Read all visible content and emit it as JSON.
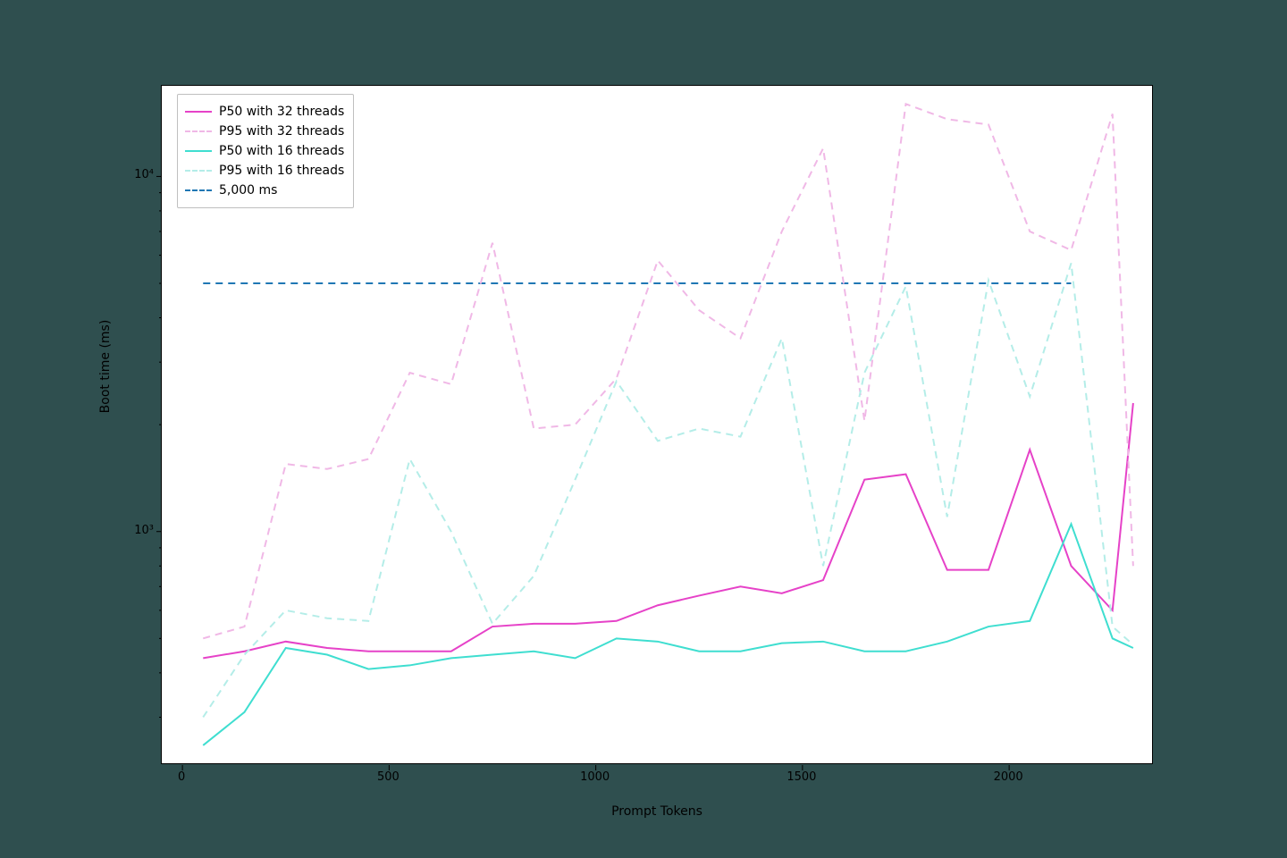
{
  "chart_data": {
    "type": "line",
    "xlabel": "Prompt Tokens",
    "ylabel": "Boot time (ms)",
    "xlim": [
      -50,
      2350
    ],
    "ylim": [
      220,
      18000
    ],
    "yscale": "log",
    "xticks": [
      0,
      500,
      1000,
      1500,
      2000
    ],
    "yticks": [
      1000,
      10000
    ],
    "ytick_labels": [
      "10³",
      "10⁴"
    ],
    "x": [
      50,
      150,
      250,
      350,
      450,
      550,
      650,
      750,
      850,
      950,
      1050,
      1150,
      1250,
      1350,
      1450,
      1550,
      1650,
      1750,
      1850,
      1950,
      2050,
      2150,
      2250
    ],
    "series": [
      {
        "name": "P50 with 32 threads",
        "color": "#e642c8",
        "style": "solid",
        "values": [
          440,
          460,
          490,
          470,
          460,
          460,
          460,
          540,
          550,
          550,
          560,
          620,
          660,
          700,
          670,
          730,
          1400,
          1450,
          780,
          780,
          1700,
          800,
          600,
          2300
        ]
      },
      {
        "name": "P95 with 32 threads",
        "color": "#f0b8e6",
        "style": "dashed",
        "values": [
          500,
          540,
          1550,
          1500,
          1600,
          2800,
          2600,
          6500,
          1950,
          2000,
          2700,
          5800,
          4200,
          3500,
          7000,
          12000,
          2050,
          16000,
          14500,
          14000,
          7000,
          6200,
          15000,
          800
        ]
      },
      {
        "name": "P50 with 16 threads",
        "color": "#3fded0",
        "style": "solid",
        "values": [
          250,
          310,
          470,
          450,
          410,
          420,
          440,
          450,
          460,
          440,
          500,
          490,
          460,
          460,
          485,
          490,
          460,
          460,
          490,
          540,
          560,
          1050,
          500,
          470
        ]
      },
      {
        "name": "P95 with 16 threads",
        "color": "#b4ede8",
        "style": "dashed",
        "values": [
          300,
          450,
          600,
          570,
          560,
          1600,
          1000,
          550,
          750,
          1400,
          2650,
          1800,
          1950,
          1850,
          3500,
          800,
          2800,
          4900,
          1100,
          5100,
          2400,
          5700,
          540,
          480
        ]
      }
    ],
    "hline": {
      "name": "5,000 ms",
      "value": 5000,
      "color": "#1f77b4",
      "style": "dashed"
    },
    "legend": [
      "P50 with 32 threads",
      "P95 with 32 threads",
      "P50 with 16 threads",
      "P95 with 16 threads",
      "5,000 ms"
    ]
  }
}
